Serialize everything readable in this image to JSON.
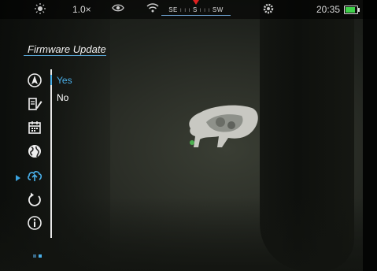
{
  "status_bar": {
    "brightness_icon": "sun-icon",
    "zoom": "1.0×",
    "mode_icon": "eye-icon",
    "wifi_icon": "wifi-icon",
    "compass": {
      "left": "SE",
      "center": "S",
      "right": "SW"
    },
    "settings_icon": "gear-icon",
    "time": "20:35",
    "battery_color": "#3fd14a"
  },
  "menu": {
    "title": "Firmware Update",
    "icons": [
      "navigation-icon",
      "edit-notes-icon",
      "calendar-icon",
      "globe-icon",
      "cloud-upload-icon",
      "refresh-icon",
      "info-icon"
    ],
    "selected_index": 4,
    "options": [
      {
        "label": "Yes",
        "selected": true
      },
      {
        "label": "No",
        "selected": false
      }
    ]
  },
  "colors": {
    "accent": "#4ab0ea"
  }
}
